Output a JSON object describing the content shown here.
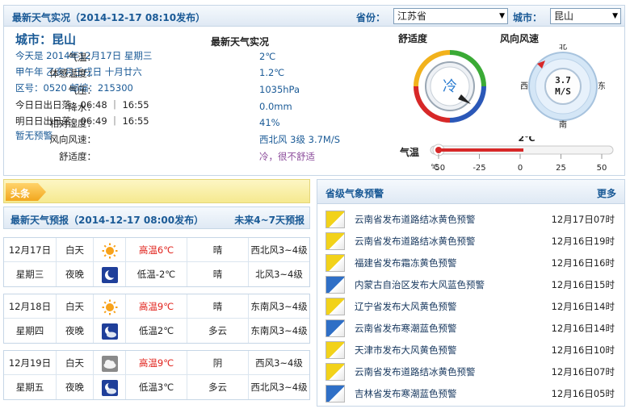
{
  "header": {
    "title": "最新天气实况（2014-12-17 08:10发布）",
    "province_label": "省份：",
    "province_value": "江苏省",
    "city_label": "城市：",
    "city_value": "昆山"
  },
  "city_info": {
    "city": "城市：昆山",
    "today": "今天是 2014年12月17日 星期三",
    "lunar": "甲午年 乙亥月壬戌日 十月廿六",
    "codes": "区号：0520  邮编：215300",
    "today_sun": "今日日出日落：06:48 ｜ 16:55",
    "tomorrow_sun": "明日日出日落：06:49 ｜ 16:55",
    "alert": "暂无预警"
  },
  "observation": {
    "title": "最新天气实况",
    "rows": [
      {
        "key": "气温：",
        "value": "2℃"
      },
      {
        "key": "体感温度：",
        "value": "1.2℃"
      },
      {
        "key": "气压：",
        "value": "1035hPa"
      },
      {
        "key": "降水：",
        "value": "0.0mm"
      },
      {
        "key": "相对湿度：",
        "value": "41%"
      },
      {
        "key": "风向风速：",
        "value": "西北风 3级 3.7M/S"
      },
      {
        "key": "舒适度：",
        "value": "冷，很不舒适"
      }
    ]
  },
  "comfort": {
    "label": "舒适度",
    "value": "冷"
  },
  "wind": {
    "label": "风向风速",
    "speed": "3.7",
    "unit": "M/S",
    "n": "北",
    "s": "南",
    "e": "东",
    "w": "西"
  },
  "temp_scale": {
    "label": "气温",
    "current": "2℃",
    "value": 2,
    "unit": "℃",
    "ticks": [
      "-50",
      "-25",
      "0",
      "25",
      "50"
    ],
    "min": -50,
    "max": 50
  },
  "notice": {
    "tag": "头条"
  },
  "forecast": {
    "title": "最新天气预报（2014-12-17  08:00发布）",
    "more": "未来4~7天预报",
    "days": [
      {
        "date": "12月17日",
        "weekday": "星期三",
        "day": {
          "label": "白天",
          "icon": "sun-icon",
          "temp": "高温6℃",
          "weather": "晴",
          "wind": "西北风3~4级"
        },
        "night": {
          "label": "夜晚",
          "icon": "moon-icon",
          "temp": "低温-2℃",
          "weather": "晴",
          "wind": "北风3~4级"
        }
      },
      {
        "date": "12月18日",
        "weekday": "星期四",
        "day": {
          "label": "白天",
          "icon": "sun-icon",
          "temp": "高温9℃",
          "weather": "晴",
          "wind": "东南风3~4级"
        },
        "night": {
          "label": "夜晚",
          "icon": "moon-cloud-icon",
          "temp": "低温2℃",
          "weather": "多云",
          "wind": "东南风3~4级"
        }
      },
      {
        "date": "12月19日",
        "weekday": "星期五",
        "day": {
          "label": "白天",
          "icon": "cloud-icon",
          "temp": "高温9℃",
          "weather": "阴",
          "wind": "西风3~4级"
        },
        "night": {
          "label": "夜晚",
          "icon": "moon-cloud-icon",
          "temp": "低温3℃",
          "weather": "多云",
          "wind": "西北风3~4级"
        }
      }
    ]
  },
  "warnings": {
    "title": "省级气象预警",
    "more": "更多",
    "items": [
      {
        "text": "云南省发布道路结冰黄色预警",
        "time": "12月17日07时",
        "color": "#f2d21a"
      },
      {
        "text": "云南省发布道路结冰黄色预警",
        "time": "12月16日19时",
        "color": "#f2d21a"
      },
      {
        "text": "福建省发布霜冻黄色预警",
        "time": "12月16日16时",
        "color": "#f2d21a"
      },
      {
        "text": "内蒙古自治区发布大风蓝色预警",
        "time": "12月16日15时",
        "color": "#2f6fc6"
      },
      {
        "text": "辽宁省发布大风黄色预警",
        "time": "12月16日14时",
        "color": "#f2d21a"
      },
      {
        "text": "云南省发布寒潮蓝色预警",
        "time": "12月16日14时",
        "color": "#2f6fc6"
      },
      {
        "text": "天津市发布大风黄色预警",
        "time": "12月16日10时",
        "color": "#f2d21a"
      },
      {
        "text": "云南省发布道路结冰黄色预警",
        "time": "12月16日07时",
        "color": "#f2d21a"
      },
      {
        "text": "吉林省发布寒潮蓝色预警",
        "time": "12月16日05时",
        "color": "#2f6fc6"
      }
    ]
  }
}
